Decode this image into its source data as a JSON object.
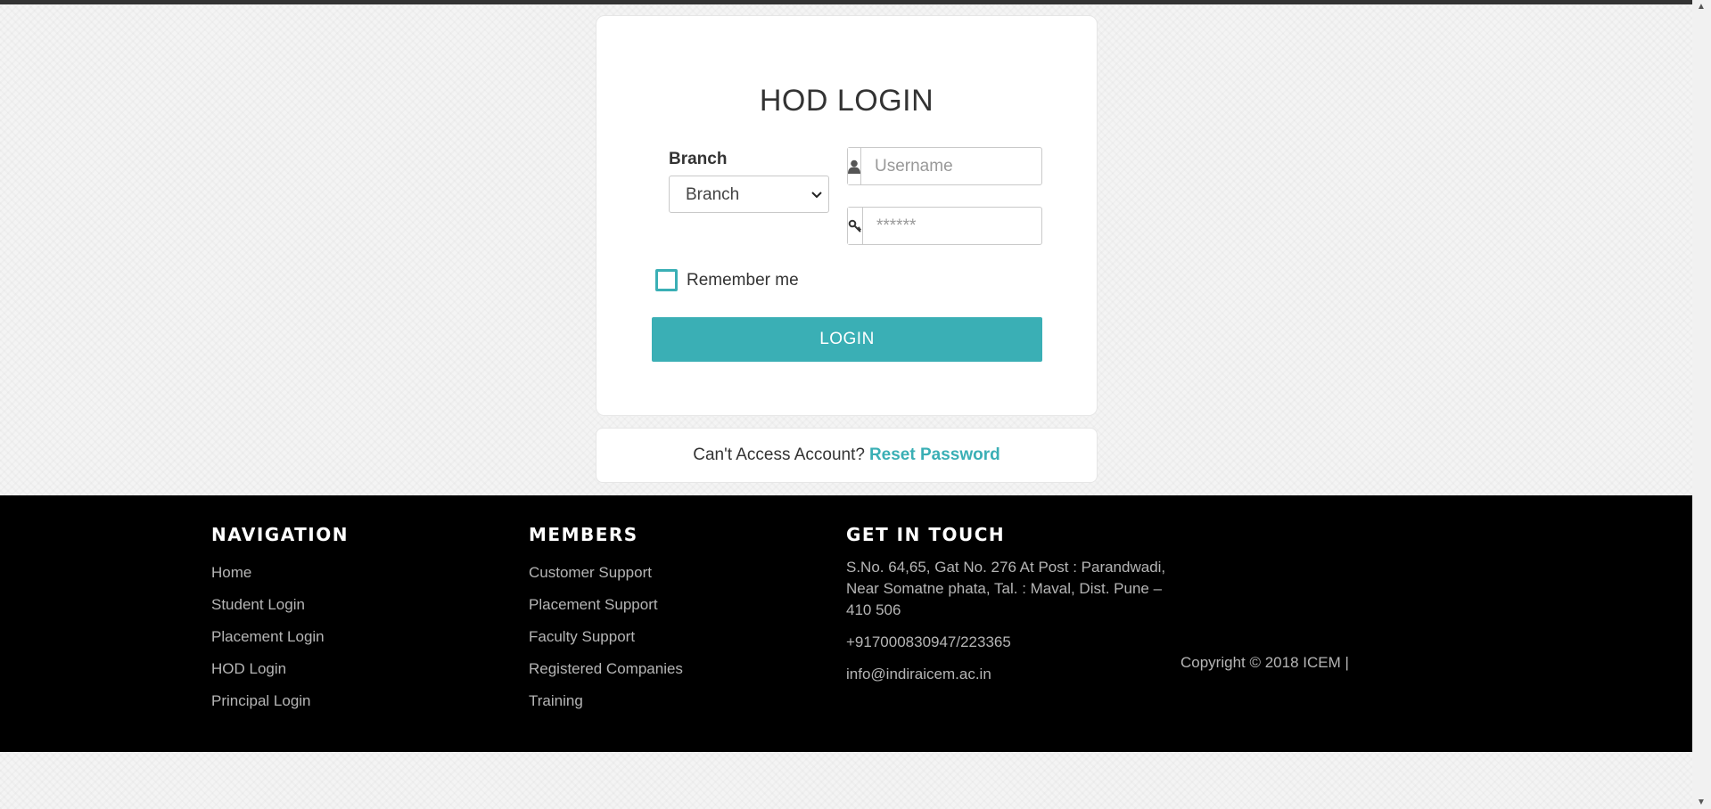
{
  "login": {
    "title": "HOD LOGIN",
    "branch_label": "Branch",
    "branch_selected": "Branch",
    "username_placeholder": "Username",
    "password_placeholder": "******",
    "remember_label": "Remember me",
    "login_button": "LOGIN"
  },
  "reset": {
    "prompt": "Can't Access Account?",
    "link": "Reset Password"
  },
  "footer": {
    "navigation": {
      "heading": "NAVIGATION",
      "items": [
        "Home",
        "Student Login",
        "Placement Login",
        "HOD Login",
        "Principal Login"
      ]
    },
    "members": {
      "heading": "MEMBERS",
      "items": [
        "Customer Support",
        "Placement Support",
        "Faculty Support",
        "Registered Companies",
        "Training"
      ]
    },
    "contact": {
      "heading": "GET IN TOUCH",
      "address": "S.No. 64,65, Gat No. 276 At Post : Parandwadi, Near Somatne phata, Tal. : Maval, Dist. Pune – 410 506",
      "phone": "+917000830947/223365",
      "email": "info@indiraicem.ac.in"
    },
    "copyright": "Copyright © 2018 ICEM |"
  },
  "icons": {
    "username": "user-icon",
    "password": "key-icon",
    "select": "chevron-down-icon"
  },
  "colors": {
    "accent": "#3aafb5",
    "footer_bg": "#000000",
    "page_bg": "#f4f4f4"
  }
}
